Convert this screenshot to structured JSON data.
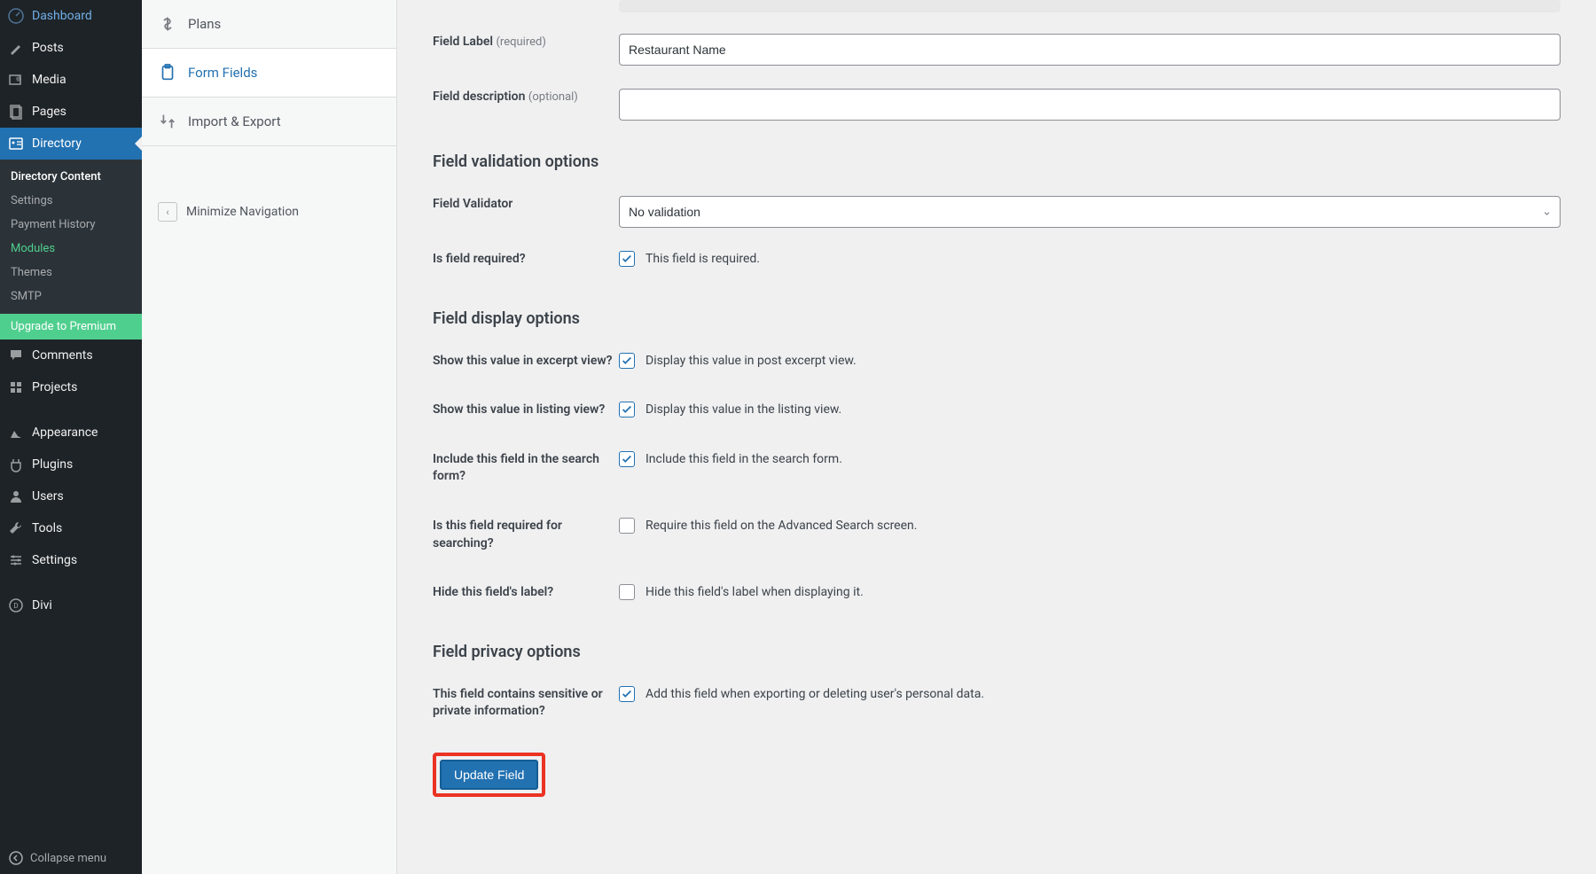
{
  "wpSidebar": {
    "dashboard": "Dashboard",
    "posts": "Posts",
    "media": "Media",
    "pages": "Pages",
    "directory": "Directory",
    "directoryContent": "Directory Content",
    "settings": "Settings",
    "paymentHistory": "Payment History",
    "modules": "Modules",
    "themes": "Themes",
    "smtp": "SMTP",
    "upgrade": "Upgrade to Premium",
    "comments": "Comments",
    "projects": "Projects",
    "appearance": "Appearance",
    "plugins": "Plugins",
    "users": "Users",
    "tools": "Tools",
    "settingsMain": "Settings",
    "divi": "Divi",
    "collapse": "Collapse menu"
  },
  "subNav": {
    "plans": "Plans",
    "formFields": "Form Fields",
    "importExport": "Import & Export",
    "minimize": "Minimize Navigation"
  },
  "form": {
    "fieldLabel": {
      "label": "Field Label",
      "hint": "(required)",
      "value": "Restaurant Name"
    },
    "fieldDescription": {
      "label": "Field description",
      "hint": "(optional)",
      "value": ""
    },
    "validationHeading": "Field validation options",
    "validator": {
      "label": "Field Validator",
      "value": "No validation"
    },
    "required": {
      "label": "Is field required?",
      "checkbox": "This field is required.",
      "checked": true
    },
    "displayHeading": "Field display options",
    "excerpt": {
      "label": "Show this value in excerpt view?",
      "checkbox": "Display this value in post excerpt view.",
      "checked": true
    },
    "listing": {
      "label": "Show this value in listing view?",
      "checkbox": "Display this value in the listing view.",
      "checked": true
    },
    "search": {
      "label": "Include this field in the search form?",
      "checkbox": "Include this field in the search form.",
      "checked": true
    },
    "searchRequired": {
      "label": "Is this field required for searching?",
      "checkbox": "Require this field on the Advanced Search screen.",
      "checked": false
    },
    "hideLabel": {
      "label": "Hide this field's label?",
      "checkbox": "Hide this field's label when displaying it.",
      "checked": false
    },
    "privacyHeading": "Field privacy options",
    "privacy": {
      "label": "This field contains sensitive or private information?",
      "checkbox": "Add this field when exporting or deleting user's personal data.",
      "checked": true
    },
    "updateBtn": "Update Field"
  }
}
